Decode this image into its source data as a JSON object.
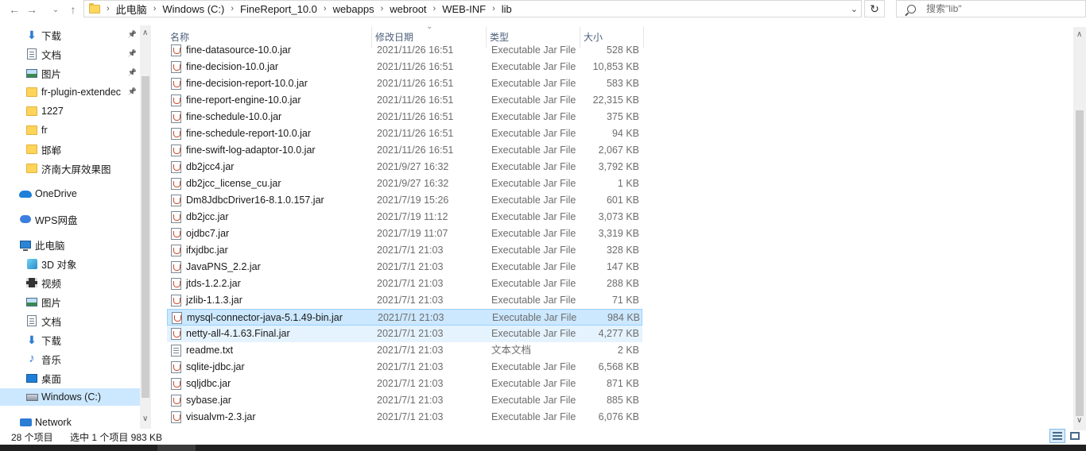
{
  "address": {
    "crumbs": [
      "此电脑",
      "Windows (C:)",
      "FineReport_10.0",
      "webapps",
      "webroot",
      "WEB-INF",
      "lib"
    ],
    "search_placeholder": "搜索\"lib\""
  },
  "nav": {
    "items": [
      {
        "label": "下载",
        "icon": "download-icon",
        "pinned": true
      },
      {
        "label": "文档",
        "icon": "document-icon",
        "pinned": true
      },
      {
        "label": "图片",
        "icon": "picture-icon",
        "pinned": true
      },
      {
        "label": "fr-plugin-extendec",
        "icon": "folder-icon",
        "pinned": true
      },
      {
        "label": "1227",
        "icon": "folder-icon"
      },
      {
        "label": "fr",
        "icon": "folder-icon"
      },
      {
        "label": "邯郸",
        "icon": "folder-icon"
      },
      {
        "label": "济南大屏效果图",
        "icon": "folder-icon"
      },
      {
        "label": "OneDrive",
        "icon": "onedrive-icon"
      },
      {
        "label": "WPS网盘",
        "icon": "wps-cloud-icon"
      },
      {
        "label": "此电脑",
        "icon": "this-pc-icon"
      },
      {
        "label": "3D 对象",
        "icon": "3d-objects-icon"
      },
      {
        "label": "视频",
        "icon": "video-icon"
      },
      {
        "label": "图片",
        "icon": "picture-icon"
      },
      {
        "label": "文档",
        "icon": "document-icon"
      },
      {
        "label": "下载",
        "icon": "download-icon"
      },
      {
        "label": "音乐",
        "icon": "music-icon"
      },
      {
        "label": "桌面",
        "icon": "desktop-icon"
      },
      {
        "label": "Windows (C:)",
        "icon": "drive-icon",
        "selected": true
      },
      {
        "label": "Network",
        "icon": "network-icon"
      }
    ]
  },
  "columns": {
    "name": "名称",
    "date": "修改日期",
    "type": "类型",
    "size": "大小"
  },
  "files": [
    {
      "name": "fine-datasource-10.0.jar",
      "date": "2021/11/26 16:51",
      "type": "Executable Jar File",
      "size": "528 KB",
      "kind": "jar"
    },
    {
      "name": "fine-decision-10.0.jar",
      "date": "2021/11/26 16:51",
      "type": "Executable Jar File",
      "size": "10,853 KB",
      "kind": "jar"
    },
    {
      "name": "fine-decision-report-10.0.jar",
      "date": "2021/11/26 16:51",
      "type": "Executable Jar File",
      "size": "583 KB",
      "kind": "jar"
    },
    {
      "name": "fine-report-engine-10.0.jar",
      "date": "2021/11/26 16:51",
      "type": "Executable Jar File",
      "size": "22,315 KB",
      "kind": "jar"
    },
    {
      "name": "fine-schedule-10.0.jar",
      "date": "2021/11/26 16:51",
      "type": "Executable Jar File",
      "size": "375 KB",
      "kind": "jar"
    },
    {
      "name": "fine-schedule-report-10.0.jar",
      "date": "2021/11/26 16:51",
      "type": "Executable Jar File",
      "size": "94 KB",
      "kind": "jar"
    },
    {
      "name": "fine-swift-log-adaptor-10.0.jar",
      "date": "2021/11/26 16:51",
      "type": "Executable Jar File",
      "size": "2,067 KB",
      "kind": "jar"
    },
    {
      "name": "db2jcc4.jar",
      "date": "2021/9/27 16:32",
      "type": "Executable Jar File",
      "size": "3,792 KB",
      "kind": "jar"
    },
    {
      "name": "db2jcc_license_cu.jar",
      "date": "2021/9/27 16:32",
      "type": "Executable Jar File",
      "size": "1 KB",
      "kind": "jar"
    },
    {
      "name": "Dm8JdbcDriver16-8.1.0.157.jar",
      "date": "2021/7/19 15:26",
      "type": "Executable Jar File",
      "size": "601 KB",
      "kind": "jar"
    },
    {
      "name": "db2jcc.jar",
      "date": "2021/7/19 11:12",
      "type": "Executable Jar File",
      "size": "3,073 KB",
      "kind": "jar"
    },
    {
      "name": "ojdbc7.jar",
      "date": "2021/7/19 11:07",
      "type": "Executable Jar File",
      "size": "3,319 KB",
      "kind": "jar"
    },
    {
      "name": "ifxjdbc.jar",
      "date": "2021/7/1 21:03",
      "type": "Executable Jar File",
      "size": "328 KB",
      "kind": "jar"
    },
    {
      "name": "JavaPNS_2.2.jar",
      "date": "2021/7/1 21:03",
      "type": "Executable Jar File",
      "size": "147 KB",
      "kind": "jar"
    },
    {
      "name": "jtds-1.2.2.jar",
      "date": "2021/7/1 21:03",
      "type": "Executable Jar File",
      "size": "288 KB",
      "kind": "jar"
    },
    {
      "name": "jzlib-1.1.3.jar",
      "date": "2021/7/1 21:03",
      "type": "Executable Jar File",
      "size": "71 KB",
      "kind": "jar"
    },
    {
      "name": "mysql-connector-java-5.1.49-bin.jar",
      "date": "2021/7/1 21:03",
      "type": "Executable Jar File",
      "size": "984 KB",
      "kind": "jar",
      "state": "sel"
    },
    {
      "name": "netty-all-4.1.63.Final.jar",
      "date": "2021/7/1 21:03",
      "type": "Executable Jar File",
      "size": "4,277 KB",
      "kind": "jar",
      "state": "hover"
    },
    {
      "name": "readme.txt",
      "date": "2021/7/1 21:03",
      "type": "文本文档",
      "size": "2 KB",
      "kind": "txt"
    },
    {
      "name": "sqlite-jdbc.jar",
      "date": "2021/7/1 21:03",
      "type": "Executable Jar File",
      "size": "6,568 KB",
      "kind": "jar"
    },
    {
      "name": "sqljdbc.jar",
      "date": "2021/7/1 21:03",
      "type": "Executable Jar File",
      "size": "871 KB",
      "kind": "jar"
    },
    {
      "name": "sybase.jar",
      "date": "2021/7/1 21:03",
      "type": "Executable Jar File",
      "size": "885 KB",
      "kind": "jar"
    },
    {
      "name": "visualvm-2.3.jar",
      "date": "2021/7/1 21:03",
      "type": "Executable Jar File",
      "size": "6,076 KB",
      "kind": "jar"
    }
  ],
  "status": {
    "count": "28 个项目",
    "selection": "选中 1 个项目  983 KB"
  }
}
